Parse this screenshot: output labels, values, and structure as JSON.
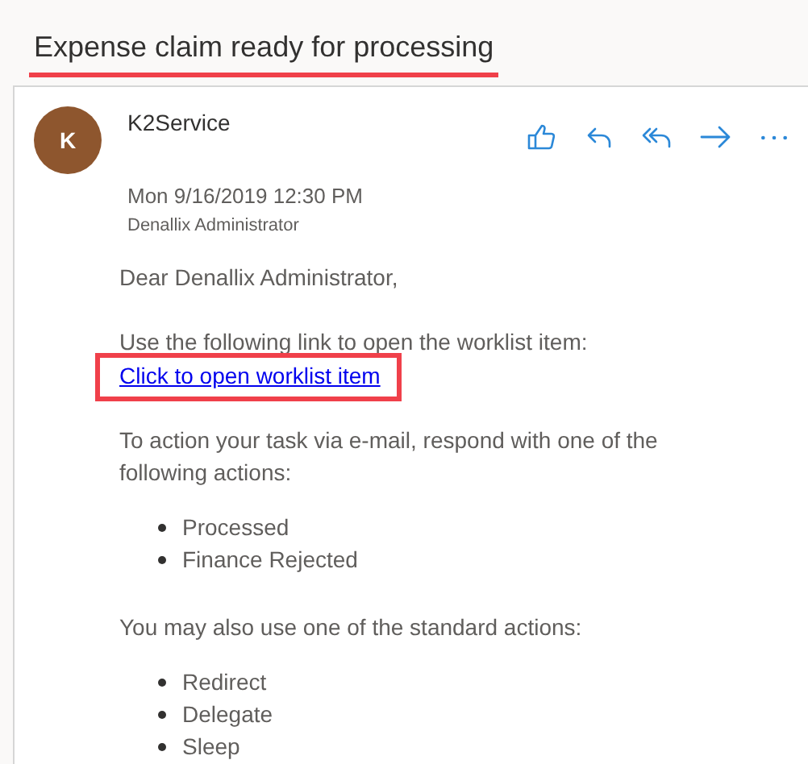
{
  "subject": {
    "text": "Expense claim ready for processing",
    "highlighted": true
  },
  "message": {
    "avatar_initial": "K",
    "sender": "K2Service",
    "date": "Mon 9/16/2019 12:30 PM",
    "recipient": "Denallix Administrator",
    "body": [
      {
        "kind": "paragraph",
        "text": "Dear Denallix Administrator,"
      },
      {
        "kind": "paragraph",
        "text": "Use the following link to open the worklist item:",
        "link": {
          "text": "Click to open worklist item",
          "highlighted": true
        }
      },
      {
        "kind": "paragraph",
        "text": "To action your task via e-mail, respond with one of the following actions:"
      },
      {
        "kind": "list",
        "items": [
          "Processed",
          "Finance Rejected"
        ]
      },
      {
        "kind": "paragraph",
        "text": "You may also use one of the standard actions:"
      },
      {
        "kind": "list",
        "items": [
          "Redirect",
          "Delegate",
          "Sleep"
        ]
      }
    ]
  }
}
